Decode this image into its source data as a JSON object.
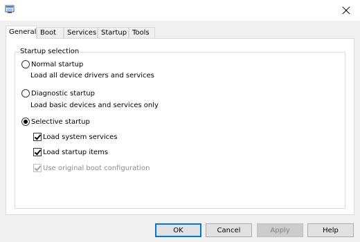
{
  "window": {
    "app_icon": "msconfig-window-icon",
    "close_icon": "close-icon"
  },
  "tabs": [
    {
      "label": "General",
      "active": true
    },
    {
      "label": "Boot",
      "active": false
    },
    {
      "label": "Services",
      "active": false
    },
    {
      "label": "Startup",
      "active": false
    },
    {
      "label": "Tools",
      "active": false
    }
  ],
  "startup_selection": {
    "group_label": "Startup selection",
    "options": [
      {
        "label": "Normal startup",
        "description": "Load all device drivers and services",
        "selected": false
      },
      {
        "label": "Diagnostic startup",
        "description": "Load basic devices and services only",
        "selected": false
      },
      {
        "label": "Selective startup",
        "selected": true
      }
    ],
    "selective_items": [
      {
        "label": "Load system services",
        "checked": true,
        "enabled": true
      },
      {
        "label": "Load startup items",
        "checked": true,
        "enabled": true
      },
      {
        "label": "Use original boot configuration",
        "checked": true,
        "enabled": false
      }
    ]
  },
  "buttons": {
    "ok": "OK",
    "cancel": "Cancel",
    "apply": "Apply",
    "help": "Help"
  }
}
